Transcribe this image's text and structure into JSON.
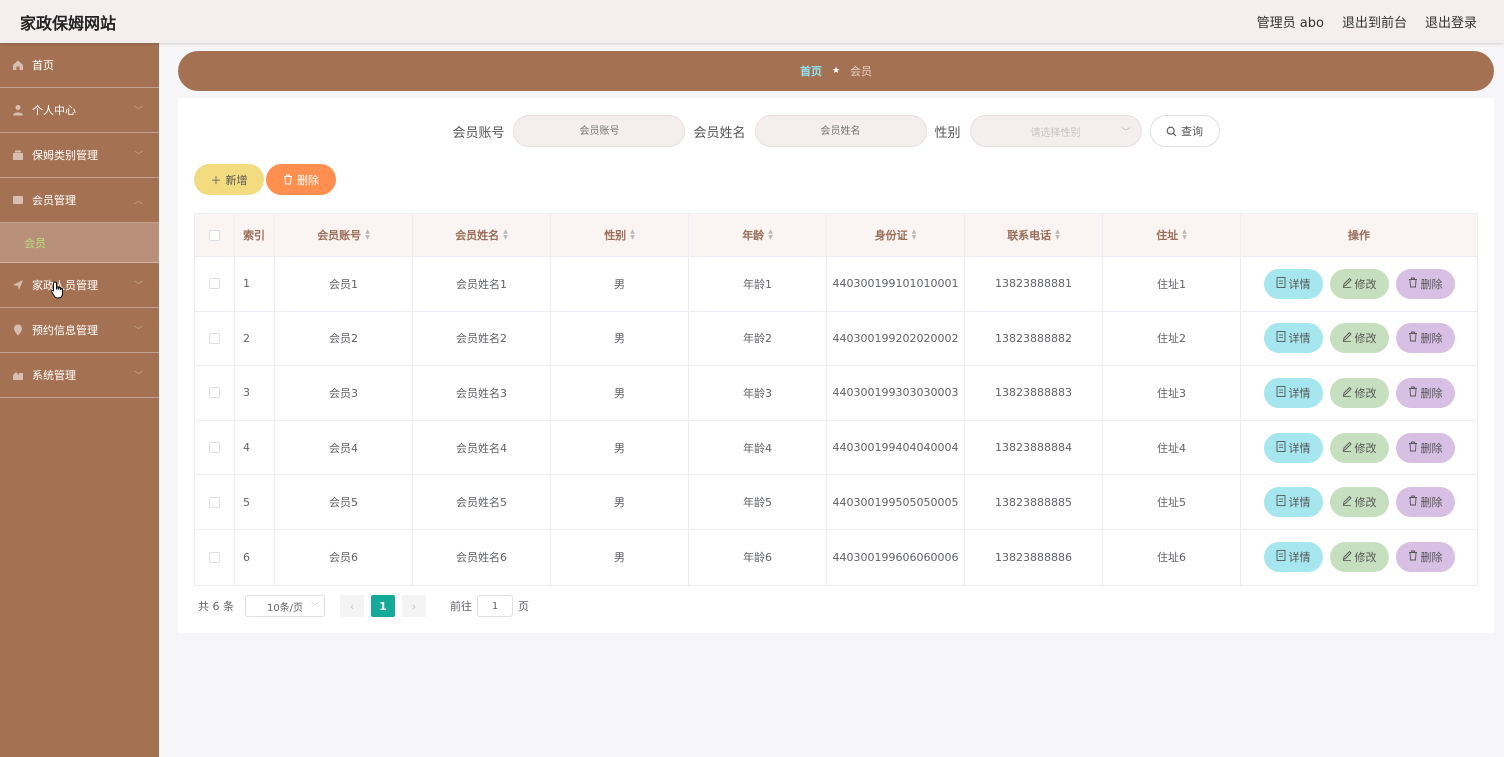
{
  "header": {
    "title": "家政保姆网站",
    "admin": "管理员 abo",
    "to_front": "退出到前台",
    "logout": "退出登录"
  },
  "sidebar": {
    "items": [
      {
        "label": "首页",
        "icon": "home-icon"
      },
      {
        "label": "个人中心",
        "icon": "user-icon"
      },
      {
        "label": "保姆类别管理",
        "icon": "category-icon"
      },
      {
        "label": "会员管理",
        "icon": "members-icon"
      },
      {
        "label": "家政人员管理",
        "icon": "send-icon"
      },
      {
        "label": "预约信息管理",
        "icon": "location-icon"
      },
      {
        "label": "系统管理",
        "icon": "settings-icon"
      }
    ],
    "submenu_label": "会员"
  },
  "breadcrumb": {
    "home": "首页",
    "current": "会员"
  },
  "search": {
    "account_label": "会员账号",
    "account_placeholder": "会员账号",
    "name_label": "会员姓名",
    "name_placeholder": "会员姓名",
    "gender_label": "性别",
    "gender_placeholder": "请选择性别",
    "query_button": "查询"
  },
  "actions": {
    "add": "新增",
    "delete": "删除"
  },
  "table": {
    "headers": {
      "index": "索引",
      "account": "会员账号",
      "name": "会员姓名",
      "gender": "性别",
      "age": "年龄",
      "id_card": "身份证",
      "phone": "联系电话",
      "address": "住址",
      "ops": "操作"
    },
    "ops": {
      "detail": "详情",
      "edit": "修改",
      "delete": "删除"
    },
    "rows": [
      {
        "index": "1",
        "account": "会员1",
        "name": "会员姓名1",
        "gender": "男",
        "age": "年龄1",
        "id_card": "440300199101010001",
        "phone": "13823888881",
        "address": "住址1"
      },
      {
        "index": "2",
        "account": "会员2",
        "name": "会员姓名2",
        "gender": "男",
        "age": "年龄2",
        "id_card": "440300199202020002",
        "phone": "13823888882",
        "address": "住址2"
      },
      {
        "index": "3",
        "account": "会员3",
        "name": "会员姓名3",
        "gender": "男",
        "age": "年龄3",
        "id_card": "440300199303030003",
        "phone": "13823888883",
        "address": "住址3"
      },
      {
        "index": "4",
        "account": "会员4",
        "name": "会员姓名4",
        "gender": "男",
        "age": "年龄4",
        "id_card": "440300199404040004",
        "phone": "13823888884",
        "address": "住址4"
      },
      {
        "index": "5",
        "account": "会员5",
        "name": "会员姓名5",
        "gender": "男",
        "age": "年龄5",
        "id_card": "440300199505050005",
        "phone": "13823888885",
        "address": "住址5"
      },
      {
        "index": "6",
        "account": "会员6",
        "name": "会员姓名6",
        "gender": "男",
        "age": "年龄6",
        "id_card": "440300199606060006",
        "phone": "13823888886",
        "address": "住址6"
      }
    ]
  },
  "pagination": {
    "total": "共 6 条",
    "page_size": "10条/页",
    "current_page": "1",
    "goto_label": "前往",
    "goto_value": "1",
    "page_unit": "页"
  },
  "colors": {
    "sidebar": "#a47253",
    "accent_page": "#15a99a",
    "add_button": "#f3dc80",
    "delete_button": "#ff8f4e",
    "detail_button": "#a6e6ee",
    "edit_button": "#c6e0bf",
    "remove_button": "#d8bfe4"
  }
}
